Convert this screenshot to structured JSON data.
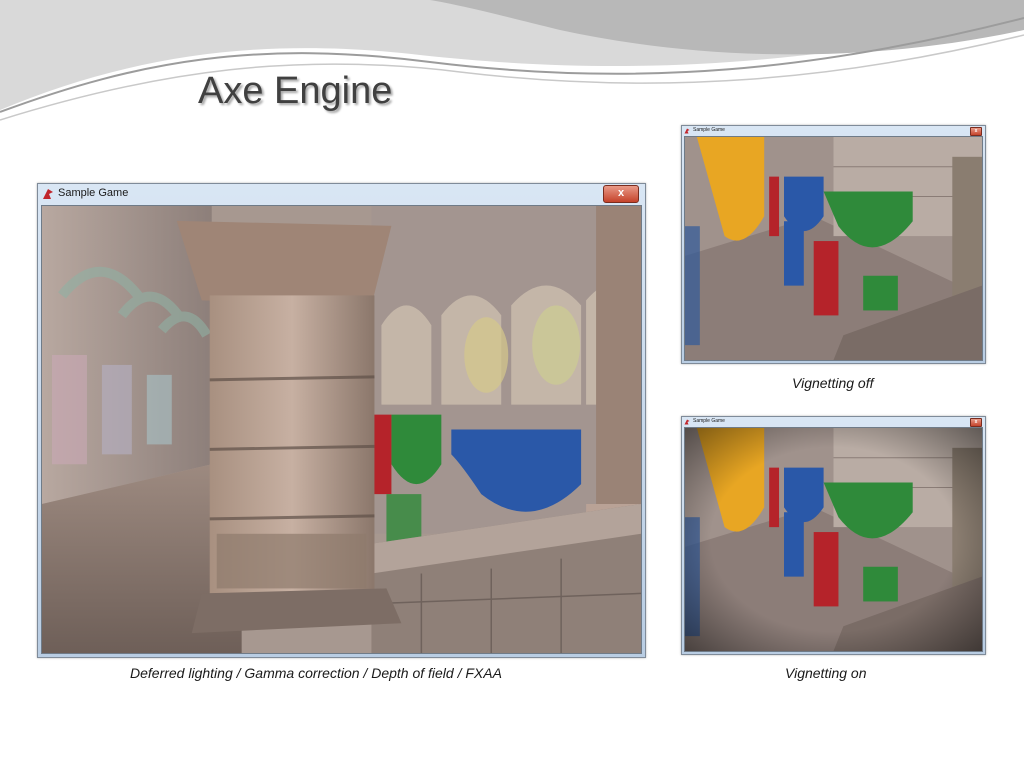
{
  "slide": {
    "title": "Axe Engine"
  },
  "main_window": {
    "title": "Sample Game",
    "close_label": "x",
    "caption": "Deferred lighting / Gamma correction / Depth of field / FXAA"
  },
  "vignette_off_window": {
    "title": "Sample Game",
    "close_label": "x",
    "caption": "Vignetting off"
  },
  "vignette_on_window": {
    "title": "Sample Game",
    "close_label": "x",
    "caption": "Vignetting on"
  },
  "colors": {
    "title_text": "#404040",
    "banner_yellow": "#e8a623",
    "banner_green": "#2f8a3a",
    "banner_blue": "#2a58a8",
    "banner_red": "#b5232a",
    "stone": "#b5a49a"
  }
}
